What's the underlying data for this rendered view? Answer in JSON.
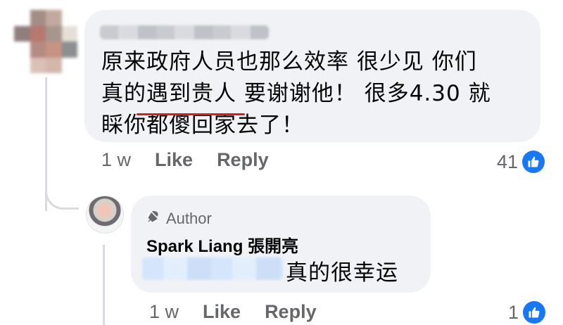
{
  "comment": {
    "text": "原来政府人员也那么效率 很少见 你们\n真的遇到贵人 要谢谢他！ 很多4.30 就\n睬你都傻回家去了！",
    "time": "1 w",
    "like_label": "Like",
    "reply_label": "Reply",
    "reaction_count": "41"
  },
  "reply": {
    "author_badge": "Author",
    "name": "Spark Liang 張開亮",
    "text": "真的很幸运",
    "time": "1 w",
    "like_label": "Like",
    "reply_label": "Reply",
    "reaction_count": "1"
  },
  "colors": {
    "bubble": "#f0f2f5",
    "like_blue": "#1877f2",
    "meta_gray": "#65676b",
    "underline_red": "#d61f1f"
  },
  "icons": {
    "reaction": "thumbs-up-icon",
    "author_badge": "microphone-icon"
  }
}
